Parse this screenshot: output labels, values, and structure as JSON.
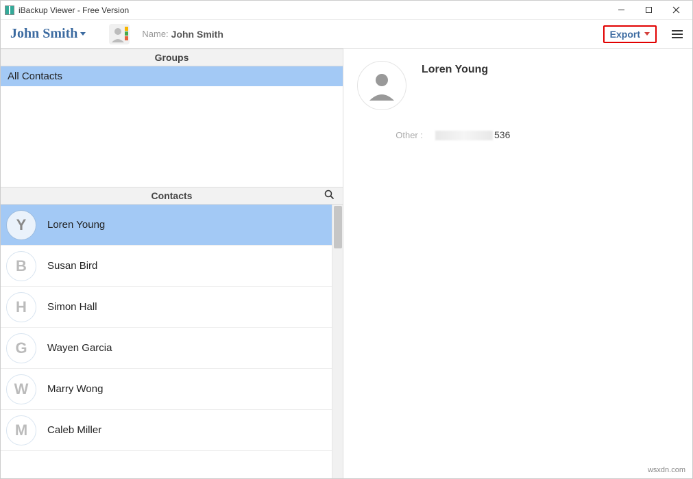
{
  "window": {
    "title": "iBackup Viewer - Free Version"
  },
  "toolbar": {
    "backup_name": "John Smith",
    "name_label": "Name:",
    "name_value": "John Smith",
    "export_label": "Export"
  },
  "groups": {
    "header": "Groups",
    "items": [
      {
        "label": "All Contacts",
        "selected": true
      }
    ]
  },
  "contacts": {
    "header": "Contacts",
    "items": [
      {
        "initial": "Y",
        "name": "Loren Young",
        "selected": true
      },
      {
        "initial": "B",
        "name": "Susan Bird",
        "selected": false
      },
      {
        "initial": "H",
        "name": "Simon Hall",
        "selected": false
      },
      {
        "initial": "G",
        "name": "Wayen Garcia",
        "selected": false
      },
      {
        "initial": "W",
        "name": "Marry Wong",
        "selected": false
      },
      {
        "initial": "M",
        "name": "Caleb Miller",
        "selected": false
      }
    ]
  },
  "detail": {
    "name": "Loren Young",
    "other_label": "Other :",
    "other_value_suffix": "536"
  },
  "watermark": "wsxdn.com"
}
